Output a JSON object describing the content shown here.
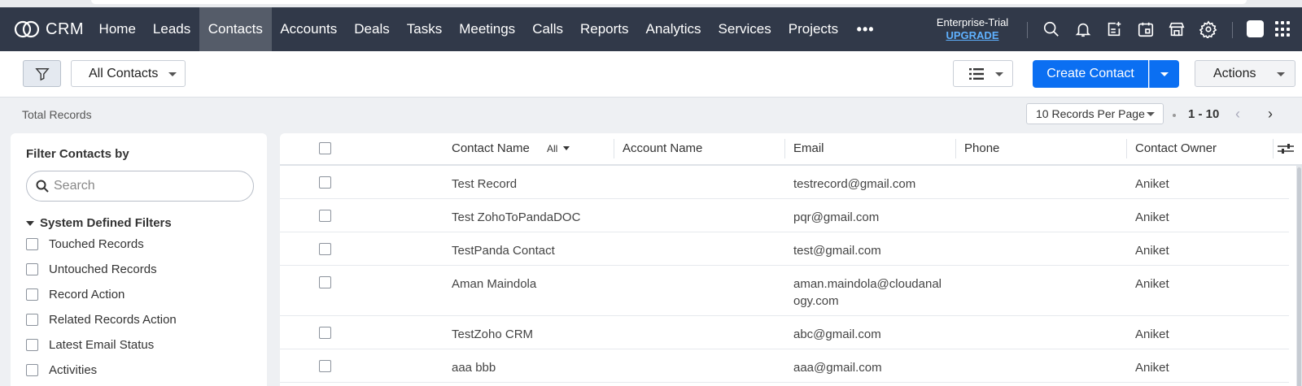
{
  "app": {
    "name": "CRM"
  },
  "nav": {
    "items": [
      {
        "label": "Home"
      },
      {
        "label": "Leads"
      },
      {
        "label": "Contacts"
      },
      {
        "label": "Accounts"
      },
      {
        "label": "Deals"
      },
      {
        "label": "Tasks"
      },
      {
        "label": "Meetings"
      },
      {
        "label": "Calls"
      },
      {
        "label": "Reports"
      },
      {
        "label": "Analytics"
      },
      {
        "label": "Services"
      },
      {
        "label": "Projects"
      }
    ],
    "active": "Contacts",
    "more": "•••",
    "trial_text": "Enterprise-Trial",
    "upgrade_label": "UPGRADE",
    "icons": [
      "search-icon",
      "bell-icon",
      "add-note-icon",
      "calendar-icon",
      "store-icon",
      "gear-icon",
      "profile-icon",
      "apps-grid-icon"
    ]
  },
  "toolbar": {
    "view_select": "All Contacts",
    "create_label": "Create Contact",
    "actions_label": "Actions"
  },
  "subbar": {
    "total_records": "Total Records",
    "per_page": "10 Records Per Page",
    "range": "1 - 10",
    "prev": "‹",
    "next": "›"
  },
  "filters": {
    "title": "Filter Contacts by",
    "search_placeholder": "Search",
    "section": "System Defined Filters",
    "options": [
      {
        "label": "Touched Records"
      },
      {
        "label": "Untouched Records"
      },
      {
        "label": "Record Action"
      },
      {
        "label": "Related Records Action"
      },
      {
        "label": "Latest Email Status"
      },
      {
        "label": "Activities"
      }
    ]
  },
  "table": {
    "columns": {
      "contact_name": "Contact Name",
      "all_filter": "All",
      "account_name": "Account Name",
      "email": "Email",
      "phone": "Phone",
      "contact_owner": "Contact Owner"
    },
    "rows": [
      {
        "name": "Test Record",
        "account": "",
        "email": "testrecord@gmail.com",
        "phone": "",
        "owner": "Aniket"
      },
      {
        "name": "Test ZohoToPandaDOC",
        "account": "",
        "email": "pqr@gmail.com",
        "phone": "",
        "owner": "Aniket"
      },
      {
        "name": "TestPanda Contact",
        "account": "",
        "email": "test@gmail.com",
        "phone": "",
        "owner": "Aniket"
      },
      {
        "name": "Aman Maindola",
        "account": "",
        "email": "aman.maindola@cloudanal",
        "email_2": "ogy.com",
        "phone": "",
        "owner": "Aniket"
      },
      {
        "name": "TestZoho CRM",
        "account": "",
        "email": "abc@gmail.com",
        "phone": "",
        "owner": "Aniket"
      },
      {
        "name": "aaa bbb",
        "account": "",
        "email": "aaa@gmail.com",
        "phone": "",
        "owner": "Aniket"
      }
    ]
  },
  "colors": {
    "navbar": "#313949",
    "nav_active": "#555c69",
    "primary": "#0b6ff2",
    "upgrade": "#5fb1ff"
  }
}
